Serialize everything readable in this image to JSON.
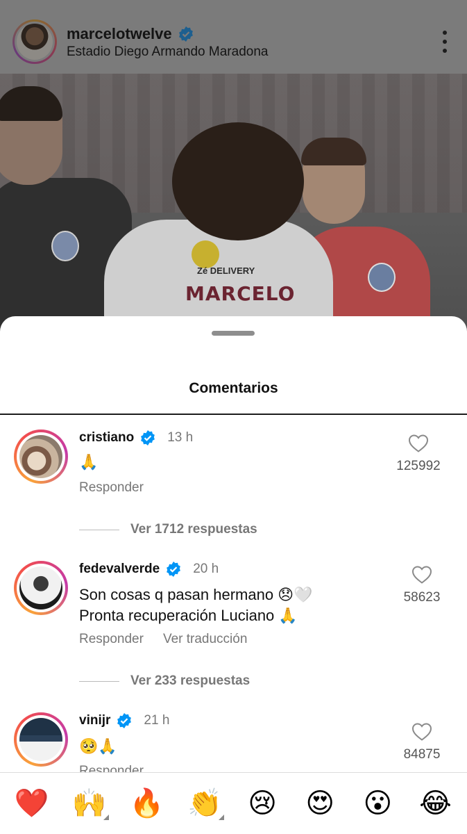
{
  "post": {
    "username": "marcelotwelve",
    "location": "Estadio Diego Armando Maradona",
    "photo": {
      "shirt_name": "MARCELO",
      "sponsor": "Zé DELIVERY"
    }
  },
  "sheet": {
    "title": "Comentarios"
  },
  "comments": [
    {
      "username": "cristiano",
      "time": "13 h",
      "text": "🙏",
      "reply_label": "Responder",
      "likes": "125992",
      "view_replies": "Ver 1712 respuestas"
    },
    {
      "username": "fedevalverde",
      "time": "20 h",
      "text_line1": "Son cosas q pasan hermano 😞🤍",
      "text_line2": "Pronta recuperación Luciano 🙏",
      "reply_label": "Responder",
      "translate_label": "Ver traducción",
      "likes": "58623",
      "view_replies": "Ver 233 respuestas"
    },
    {
      "username": "vinijr",
      "time": "21 h",
      "text": "🥺🙏",
      "reply_label": "Responder",
      "likes": "84875"
    }
  ],
  "emoji_bar": [
    {
      "emoji": "❤️",
      "name": "red-heart"
    },
    {
      "emoji": "🙌",
      "name": "raising-hands"
    },
    {
      "emoji": "🔥",
      "name": "fire"
    },
    {
      "emoji": "👏",
      "name": "clapping-hands"
    },
    {
      "emoji": "😢",
      "name": "crying-face"
    },
    {
      "emoji": "😍",
      "name": "heart-eyes"
    },
    {
      "emoji": "😮",
      "name": "surprised-face"
    },
    {
      "emoji": "😂",
      "name": "tears-of-joy"
    }
  ],
  "colors": {
    "verified_blue": "#0095f6",
    "dim_overlay": "#7b7b7b",
    "secondary_text": "#777777"
  }
}
